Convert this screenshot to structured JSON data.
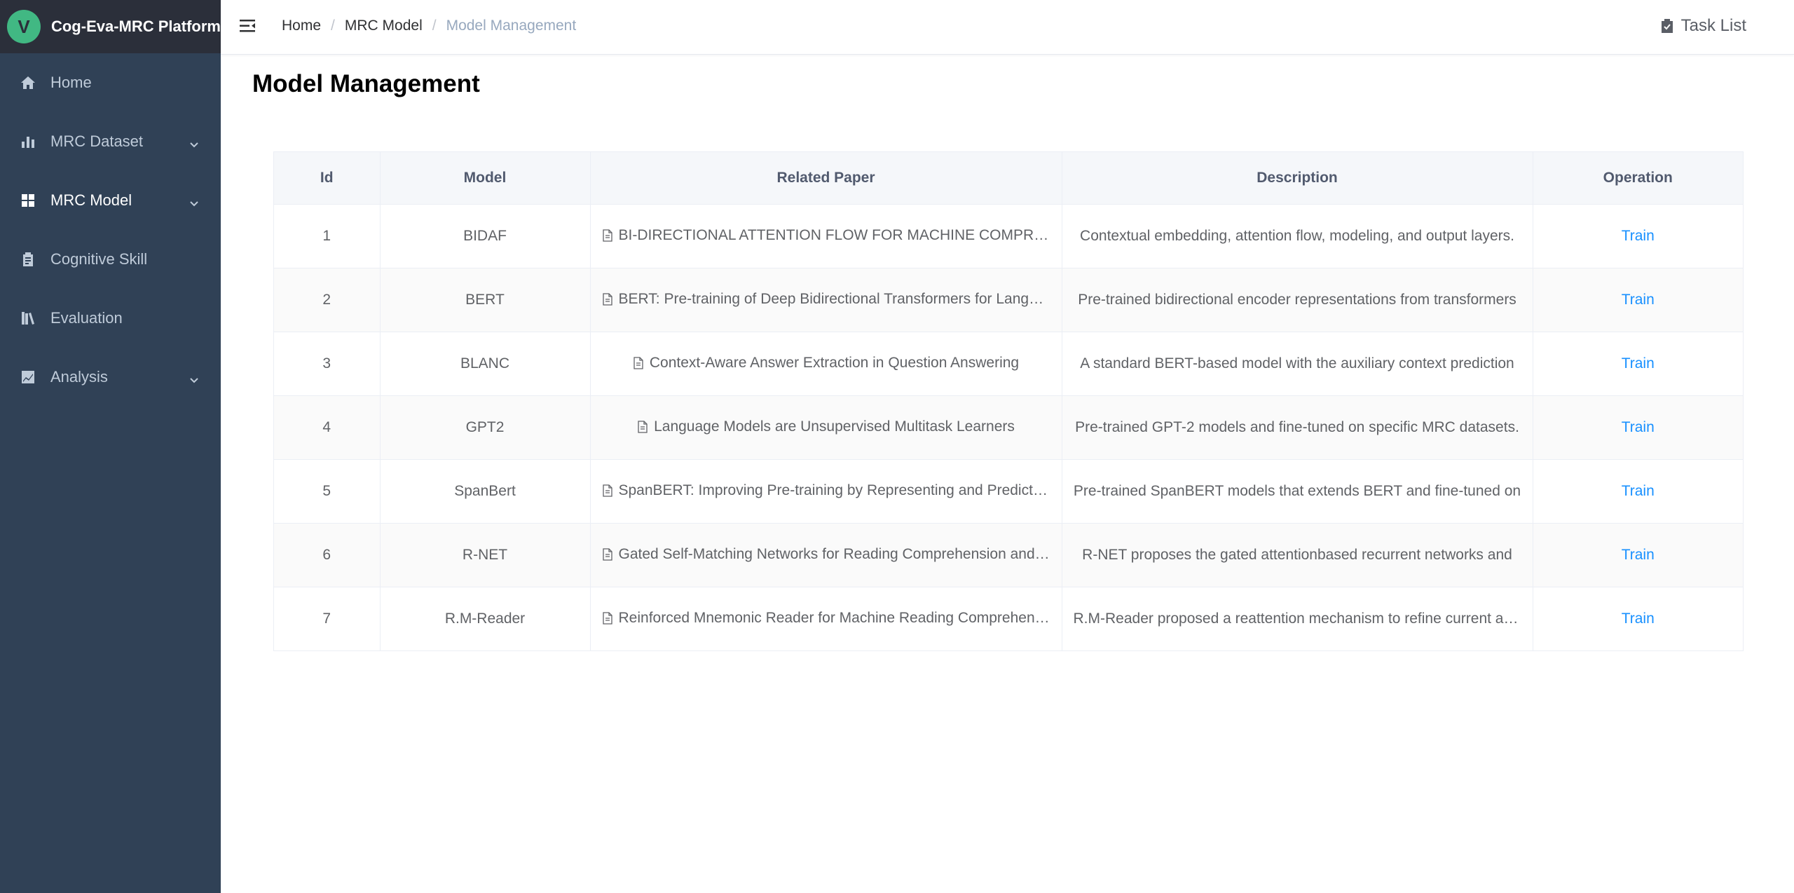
{
  "app": {
    "title": "Cog-Eva-MRC Platform",
    "logo_letter": "V",
    "logo_color": "#41b883"
  },
  "sidebar": {
    "items": [
      {
        "label": "Home",
        "icon": "home-icon",
        "active": false,
        "expandable": false
      },
      {
        "label": "MRC Dataset",
        "icon": "bar-chart-icon",
        "active": false,
        "expandable": true
      },
      {
        "label": "MRC Model",
        "icon": "grid-icon",
        "active": true,
        "expandable": true
      },
      {
        "label": "Cognitive Skill",
        "icon": "clipboard-icon",
        "active": false,
        "expandable": false
      },
      {
        "label": "Evaluation",
        "icon": "books-icon",
        "active": false,
        "expandable": false
      },
      {
        "label": "Analysis",
        "icon": "line-chart-icon",
        "active": false,
        "expandable": true
      }
    ]
  },
  "breadcrumb": [
    "Home",
    "MRC Model",
    "Model Management"
  ],
  "header": {
    "task_list": "Task List"
  },
  "page": {
    "title": "Model Management"
  },
  "table": {
    "columns": [
      "Id",
      "Model",
      "Related Paper",
      "Description",
      "Operation"
    ],
    "rows": [
      {
        "id": "1",
        "model": "BIDAF",
        "paper": "BI-DIRECTIONAL ATTENTION FLOW FOR MACHINE COMPREHENSION",
        "description": "Contextual embedding, attention flow, modeling, and output layers.",
        "operation": "Train"
      },
      {
        "id": "2",
        "model": "BERT",
        "paper": "BERT: Pre-training of Deep Bidirectional Transformers for Language Understanding",
        "description": "Pre-trained bidirectional encoder representations from transformers",
        "operation": "Train"
      },
      {
        "id": "3",
        "model": "BLANC",
        "paper": "Context-Aware Answer Extraction in Question Answering",
        "description": "A standard BERT-based model with the auxiliary context prediction",
        "operation": "Train"
      },
      {
        "id": "4",
        "model": "GPT2",
        "paper": "Language Models are Unsupervised Multitask Learners",
        "description": "Pre-trained GPT-2 models and fine-tuned on specific MRC datasets.",
        "operation": "Train"
      },
      {
        "id": "5",
        "model": "SpanBert",
        "paper": "SpanBERT: Improving Pre-training by Representing and Predicting Spans",
        "description": "Pre-trained SpanBERT models that extends BERT and fine-tuned on",
        "operation": "Train"
      },
      {
        "id": "6",
        "model": "R-NET",
        "paper": "Gated Self-Matching Networks for Reading Comprehension and Question Answering",
        "description": "R-NET proposes the gated attentionbased recurrent networks and",
        "operation": "Train"
      },
      {
        "id": "7",
        "model": "R.M-Reader",
        "paper": "Reinforced Mnemonic Reader for Machine Reading Comprehension",
        "description": "R.M-Reader proposed a reattention mechanism to refine current attentions",
        "operation": "Train"
      }
    ]
  }
}
